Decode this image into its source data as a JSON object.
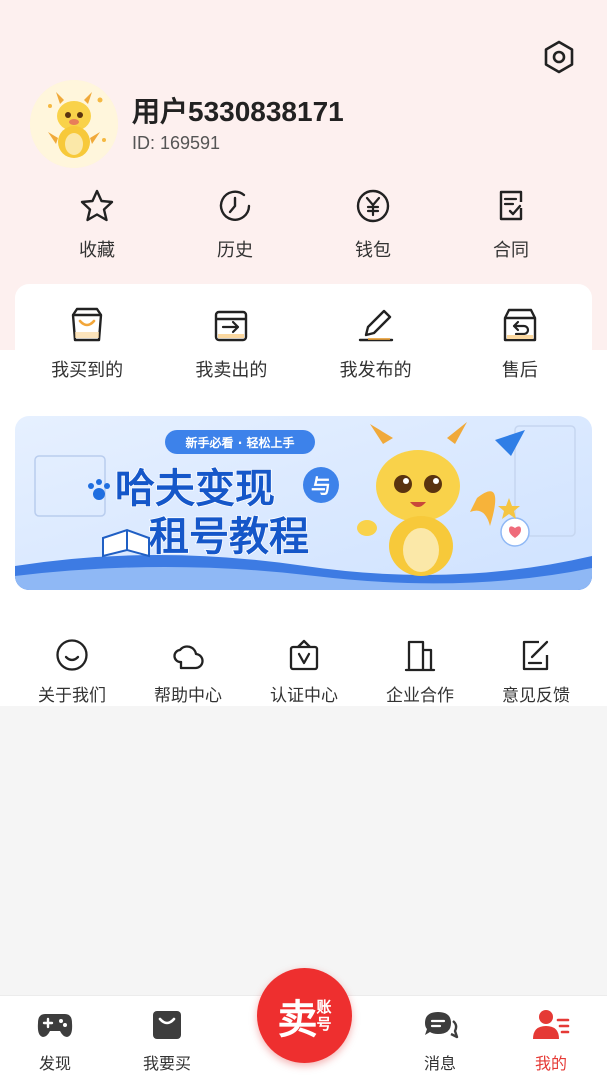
{
  "profile": {
    "username": "用户5330838171",
    "id_text": "ID: 169591"
  },
  "header": {
    "settings_icon": "settings-hex-icon"
  },
  "quick_actions": [
    {
      "label": "收藏",
      "icon": "star-icon"
    },
    {
      "label": "历史",
      "icon": "history-clock-icon"
    },
    {
      "label": "钱包",
      "icon": "wallet-yen-icon"
    },
    {
      "label": "合同",
      "icon": "contract-icon"
    }
  ],
  "orders": [
    {
      "label": "我买到的",
      "icon": "shopping-bag-icon"
    },
    {
      "label": "我卖出的",
      "icon": "sold-box-icon"
    },
    {
      "label": "我发布的",
      "icon": "edit-pencil-icon"
    },
    {
      "label": "售后",
      "icon": "return-box-icon"
    }
  ],
  "banner": {
    "tag": "新手必看 · 轻松上手",
    "line1": "哈夫变现",
    "connector": "与",
    "line2": "租号教程"
  },
  "services": [
    {
      "label": "关于我们",
      "icon": "smile-icon"
    },
    {
      "label": "帮助中心",
      "icon": "help-cloud-icon"
    },
    {
      "label": "认证中心",
      "icon": "verify-icon"
    },
    {
      "label": "企业合作",
      "icon": "building-icon"
    },
    {
      "label": "意见反馈",
      "icon": "feedback-icon"
    }
  ],
  "tabbar": {
    "discover": "发现",
    "buy": "我要买",
    "sell_main": "卖",
    "sell_sub1": "账",
    "sell_sub2": "号",
    "messages": "消息",
    "mine": "我的"
  },
  "colors": {
    "accent": "#ee2f2f",
    "header_bg": "#fdf0ef",
    "active_tab": "#e53935"
  }
}
